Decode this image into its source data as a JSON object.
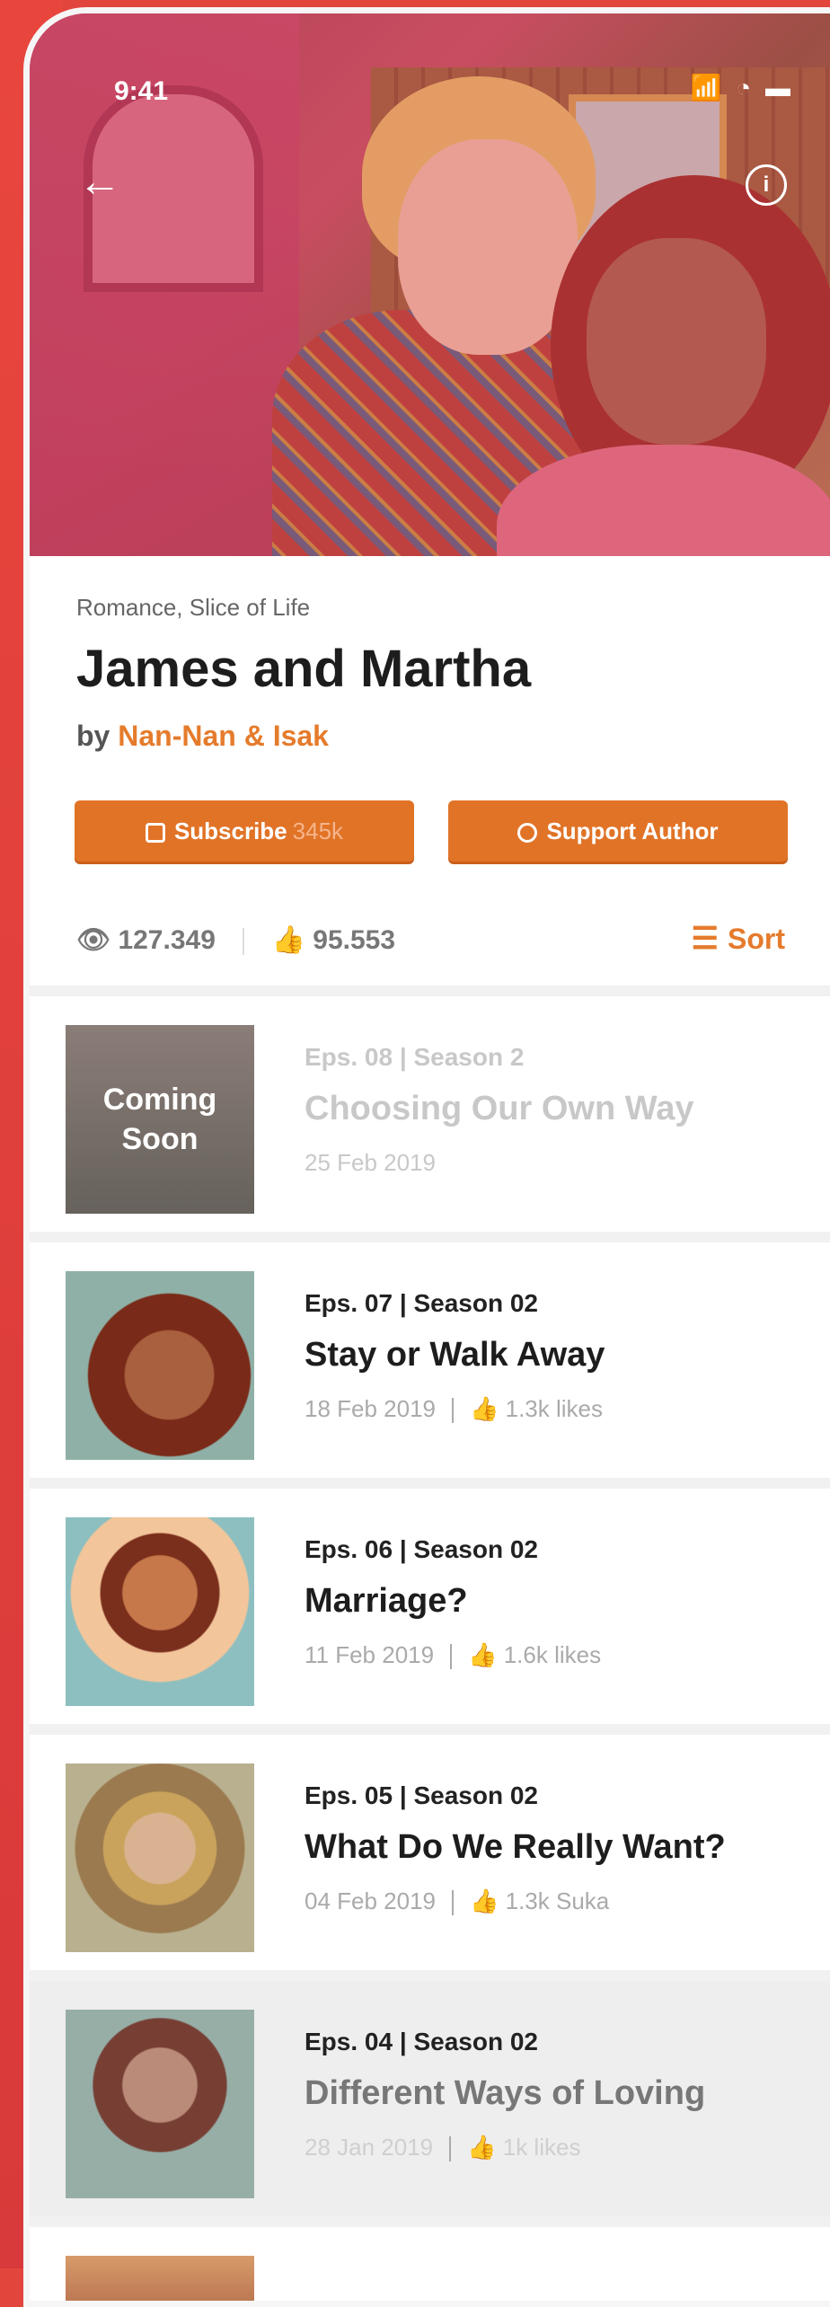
{
  "status": {
    "time": "9:41",
    "icons": "📶 ◔ ▬"
  },
  "hero": {
    "back_icon": "arrow-left-icon",
    "info_icon": "info-icon",
    "info_glyph": "i"
  },
  "comic": {
    "genre": "Romance, Slice of Life",
    "title": "James and Martha",
    "by_prefix": "by",
    "author": "Nan-Nan & Isak"
  },
  "actions": {
    "subscribe_label": "Subscribe",
    "subscribe_count": "345k",
    "support_label": "Support Author"
  },
  "stats": {
    "views": "127.349",
    "likes": "95.553",
    "sort_label": "Sort"
  },
  "episodes": [
    {
      "ep": "Eps. 08 | Season 2",
      "title": "Choosing Our Own Way",
      "date": "25 Feb 2019",
      "likes": "",
      "badge": "Coming Soon"
    },
    {
      "ep": "Eps. 07 | Season 02",
      "title": "Stay or Walk Away",
      "date": "18 Feb 2019",
      "likes": "1.3k likes"
    },
    {
      "ep": "Eps. 06 | Season 02",
      "title": "Marriage?",
      "date": "11 Feb 2019",
      "likes": "1.6k likes"
    },
    {
      "ep": "Eps. 05 | Season 02",
      "title": "What Do We Really Want?",
      "date": "04 Feb 2019",
      "likes": "1.3k Suka"
    },
    {
      "ep": "Eps. 04 | Season 02",
      "title": "Different Ways of Loving",
      "date": "28 Jan 2019",
      "likes": "1k likes"
    }
  ],
  "colors": {
    "accent": "#e17327",
    "background": "#e2453c"
  }
}
